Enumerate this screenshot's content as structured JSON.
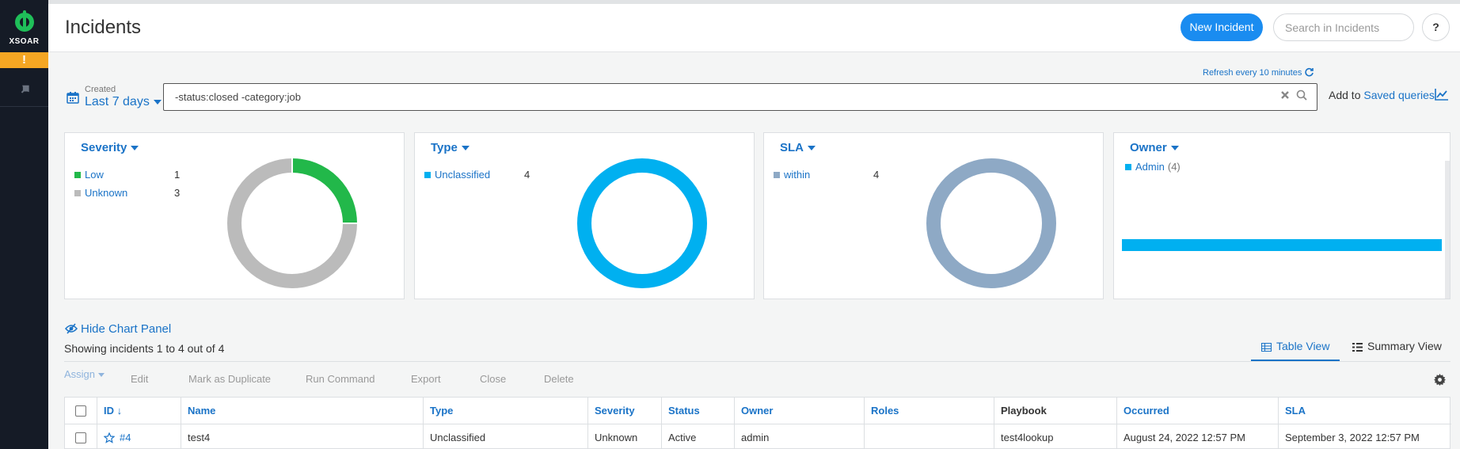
{
  "brand": {
    "name": "XSOAR",
    "alert_glyph": "!"
  },
  "header": {
    "title": "Incidents",
    "new_button": "New Incident",
    "search_placeholder": "Search in Incidents",
    "help": "?"
  },
  "query": {
    "refresh_text": "Refresh every 10 minutes",
    "date_caption": "Created",
    "date_value": "Last 7 days",
    "text": "-status:closed -category:job",
    "add_to": "Add to",
    "saved_queries": "Saved queries"
  },
  "colors": {
    "accent": "#1a73c7",
    "low": "#22b84a",
    "unknown": "#bbbbbb",
    "unclassified": "#00b0f0",
    "within": "#8ea9c5"
  },
  "widgets": {
    "severity": {
      "title": "Severity",
      "items": [
        {
          "label": "Low",
          "count": "1",
          "value": 1,
          "color": "#22b84a"
        },
        {
          "label": "Unknown",
          "count": "3",
          "value": 3,
          "color": "#bbbbbb"
        }
      ]
    },
    "type": {
      "title": "Type",
      "items": [
        {
          "label": "Unclassified",
          "count": "4",
          "value": 4,
          "color": "#00b0f0"
        }
      ]
    },
    "sla": {
      "title": "SLA",
      "items": [
        {
          "label": "within",
          "count": "4",
          "value": 4,
          "color": "#8ea9c5"
        }
      ]
    },
    "owner": {
      "title": "Owner",
      "items": [
        {
          "label": "Admin",
          "count": "(4)",
          "value": 4,
          "color": "#00b0f0"
        }
      ],
      "max": 4
    }
  },
  "panel": {
    "hide_label": "Hide Chart Panel",
    "showing": "Showing incidents 1 to 4 out of 4",
    "tabs": [
      "Table View",
      "Summary View"
    ]
  },
  "toolbar": {
    "assign": "Assign",
    "edit": "Edit",
    "duplicate": "Mark as Duplicate",
    "run": "Run Command",
    "export": "Export",
    "close": "Close",
    "delete": "Delete"
  },
  "table": {
    "headers": {
      "id": "ID ↓",
      "name": "Name",
      "type": "Type",
      "severity": "Severity",
      "status": "Status",
      "owner": "Owner",
      "roles": "Roles",
      "playbook": "Playbook",
      "occurred": "Occurred",
      "sla": "SLA"
    },
    "rows": [
      {
        "id": "#4",
        "name": "test4",
        "type": "Unclassified",
        "severity": "Unknown",
        "status": "Active",
        "owner": "admin",
        "roles": "",
        "playbook": "test4lookup",
        "occurred": "August 24, 2022 12:57 PM",
        "sla": "September 3, 2022 12:57 PM"
      }
    ]
  }
}
